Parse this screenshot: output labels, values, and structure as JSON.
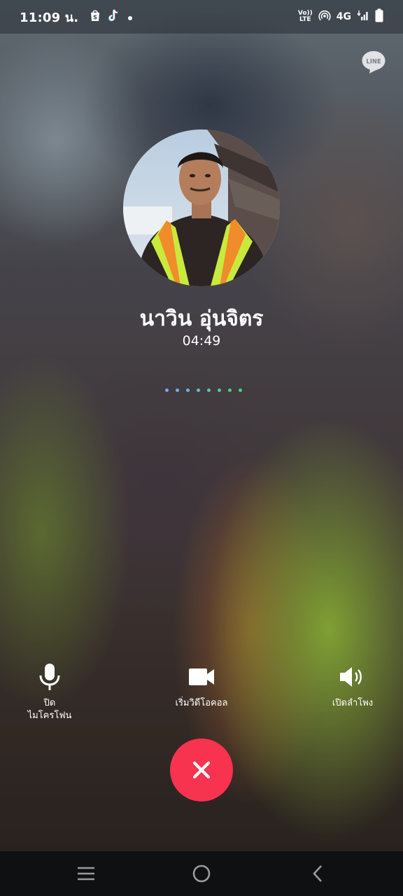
{
  "status_bar": {
    "time": "11:09 น.",
    "volte_top": "Vo))",
    "volte_bottom": "LTE",
    "network": "4G",
    "icons": [
      "shopee-icon",
      "tiktok-icon",
      "notification-dot-icon",
      "volte-icon",
      "hotspot-icon",
      "signal-icon",
      "battery-icon"
    ]
  },
  "app": {
    "logo_text": "LINE"
  },
  "call": {
    "caller_name": "นาวิน อุ่นจิตร",
    "duration": "04:49",
    "dot_colors": [
      "#7aa8e8",
      "#74ade0",
      "#6eb3d6",
      "#68b9c9",
      "#62bfb8",
      "#5cc4a4",
      "#56c98e",
      "#50cd78"
    ]
  },
  "controls": {
    "mute_line1": "ปิด",
    "mute_line2": "ไมโครโฟน",
    "video_label": "เริ่มวิดีโอคอล",
    "speaker_label": "เปิดลำโพง"
  },
  "colors": {
    "end_call": "#f7334f",
    "nav_bar": "#0f1012"
  }
}
